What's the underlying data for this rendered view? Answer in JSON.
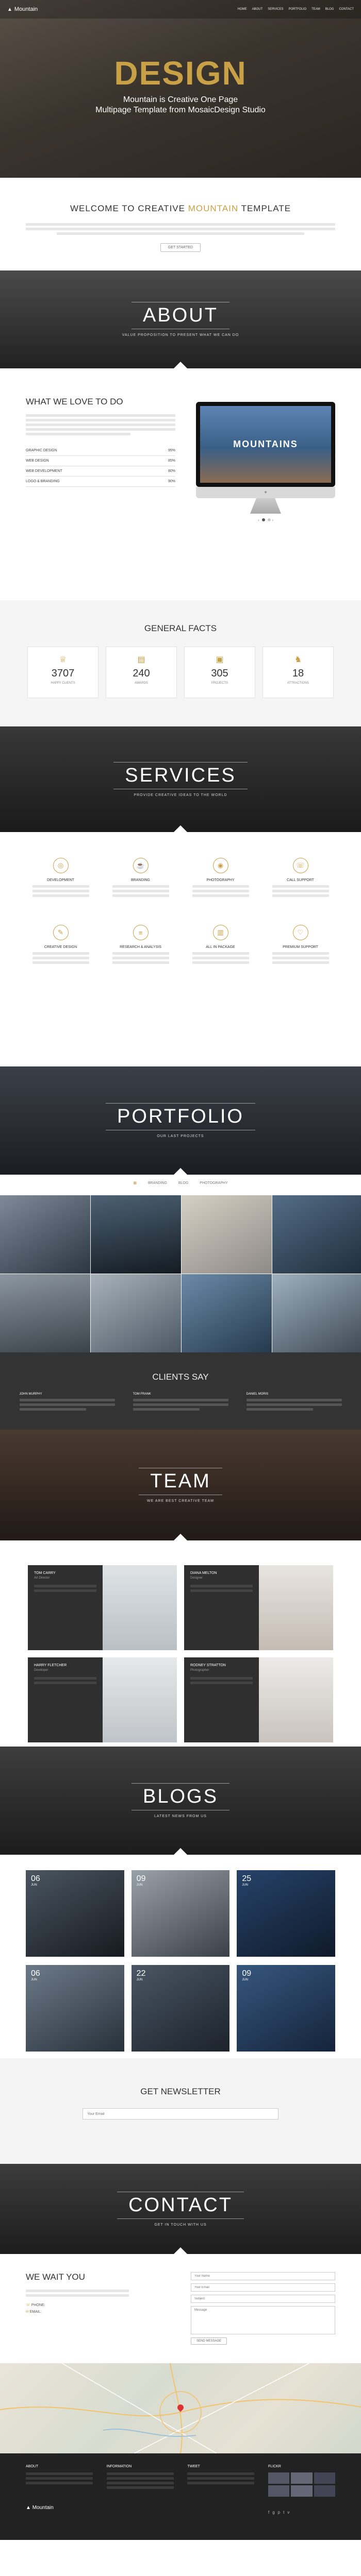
{
  "nav": {
    "logo": "Mountain",
    "items": [
      "HOME",
      "ABOUT",
      "SERVICES",
      "PORTFOLIO",
      "TEAM",
      "BLOG",
      "CONTACT"
    ]
  },
  "hero": {
    "title": "DESIGN",
    "subtitle_line1": "Mountain is Creative One Page",
    "subtitle_line2": "Multipage Template from MosaicDesign Studio"
  },
  "welcome": {
    "title_pre": "WELCOME TO CREATIVE",
    "title_accent": "MOUNTAIN",
    "title_post": "TEMPLATE",
    "button": "GET STARTED"
  },
  "about": {
    "title": "ABOUT",
    "subtitle": "VALUE PROPOSITION TO PRESENT WHAT WE CAN DO"
  },
  "love": {
    "title": "WHAT WE LOVE TO DO",
    "skills": [
      {
        "label": "GRAPHIC DESIGN",
        "value": "95%"
      },
      {
        "label": "WEB DESIGN",
        "value": "85%"
      },
      {
        "label": "WEB DEVELOPMENT",
        "value": "80%"
      },
      {
        "label": "LOGO & BRANDING",
        "value": "90%"
      }
    ],
    "screen_text": "MOUNTAINS"
  },
  "facts": {
    "title": "GENERAL FACTS",
    "items": [
      {
        "icon": "trophy-icon",
        "glyph": "♕",
        "value": "3707",
        "label": "HAPPY CLIENTS"
      },
      {
        "icon": "book-icon",
        "glyph": "▤",
        "value": "240",
        "label": "AWARDS"
      },
      {
        "icon": "briefcase-icon",
        "glyph": "▣",
        "value": "305",
        "label": "PROJECTS"
      },
      {
        "icon": "bike-icon",
        "glyph": "♞",
        "value": "18",
        "label": "ATTRACTIONS"
      }
    ]
  },
  "services": {
    "title": "SERVICES",
    "subtitle": "PROVIDE CREATIVE IDEAS TO THE WORLD",
    "items": [
      {
        "icon": "target-icon",
        "glyph": "◎",
        "label": "DEVELOPMENT"
      },
      {
        "icon": "coffee-icon",
        "glyph": "☕",
        "label": "BRANDING"
      },
      {
        "icon": "camera-icon",
        "glyph": "◉",
        "label": "PHOTOGRAPHY"
      },
      {
        "icon": "phone-icon",
        "glyph": "☏",
        "label": "CALL SUPPORT"
      },
      {
        "icon": "brush-icon",
        "glyph": "✎",
        "label": "CREATIVE DESIGN"
      },
      {
        "icon": "lines-icon",
        "glyph": "≡",
        "label": "RESEARCH & ANALYSIS"
      },
      {
        "icon": "bag-icon",
        "glyph": "▥",
        "label": "ALL IN PACKAGE"
      },
      {
        "icon": "heart-icon",
        "glyph": "♡",
        "label": "PREMIUM SUPPORT"
      }
    ]
  },
  "portfolio": {
    "title": "PORTFOLIO",
    "subtitle": "OUR LAST PROJECTS",
    "filters": [
      "BRANDING",
      "BLOG",
      "PHOTOGRAPHY"
    ]
  },
  "clients": {
    "title": "CLIENTS SAY",
    "items": [
      {
        "name": "JOHN MURPHY"
      },
      {
        "name": "TOM FRANK"
      },
      {
        "name": "DANIEL MORIS"
      }
    ]
  },
  "team": {
    "title": "TEAM",
    "subtitle": "WE ARE BEST CREATIVE TEAM",
    "members": [
      {
        "name": "TOM CARRY",
        "role": "Art Director"
      },
      {
        "name": "DIANA MELTON",
        "role": "Designer"
      },
      {
        "name": "HARRY FLETCHER",
        "role": "Developer"
      },
      {
        "name": "RODNEY STRATTON",
        "role": "Photographer"
      }
    ]
  },
  "blogs": {
    "title": "BLOGS",
    "subtitle": "LATEST NEWS FROM US",
    "posts": [
      {
        "day": "06",
        "month": "JUN"
      },
      {
        "day": "09",
        "month": "JUN"
      },
      {
        "day": "25",
        "month": "JUN"
      },
      {
        "day": "06",
        "month": "JUN"
      },
      {
        "day": "22",
        "month": "JUN"
      },
      {
        "day": "09",
        "month": "JUN"
      }
    ]
  },
  "newsletter": {
    "title": "GET NEWSLETTER",
    "placeholder": "Your Email"
  },
  "contact": {
    "title": "CONTACT",
    "subtitle": "GET IN TOUCH WITH US",
    "wait_title": "WE WAIT YOU",
    "phone_label": "PHONE:",
    "email_label": "EMAIL:",
    "name_ph": "Your Name",
    "email_ph": "Your Email",
    "subject_ph": "Subject",
    "message_ph": "Message",
    "button": "SEND MESSAGE"
  },
  "footer": {
    "logo": "Mountain",
    "col1": "ABOUT",
    "col2": "INFORMATION",
    "col3": "TWEET",
    "col4": "FLICKR"
  },
  "colors": {
    "accent": "#c8a046",
    "dark": "#2a2a2a"
  }
}
